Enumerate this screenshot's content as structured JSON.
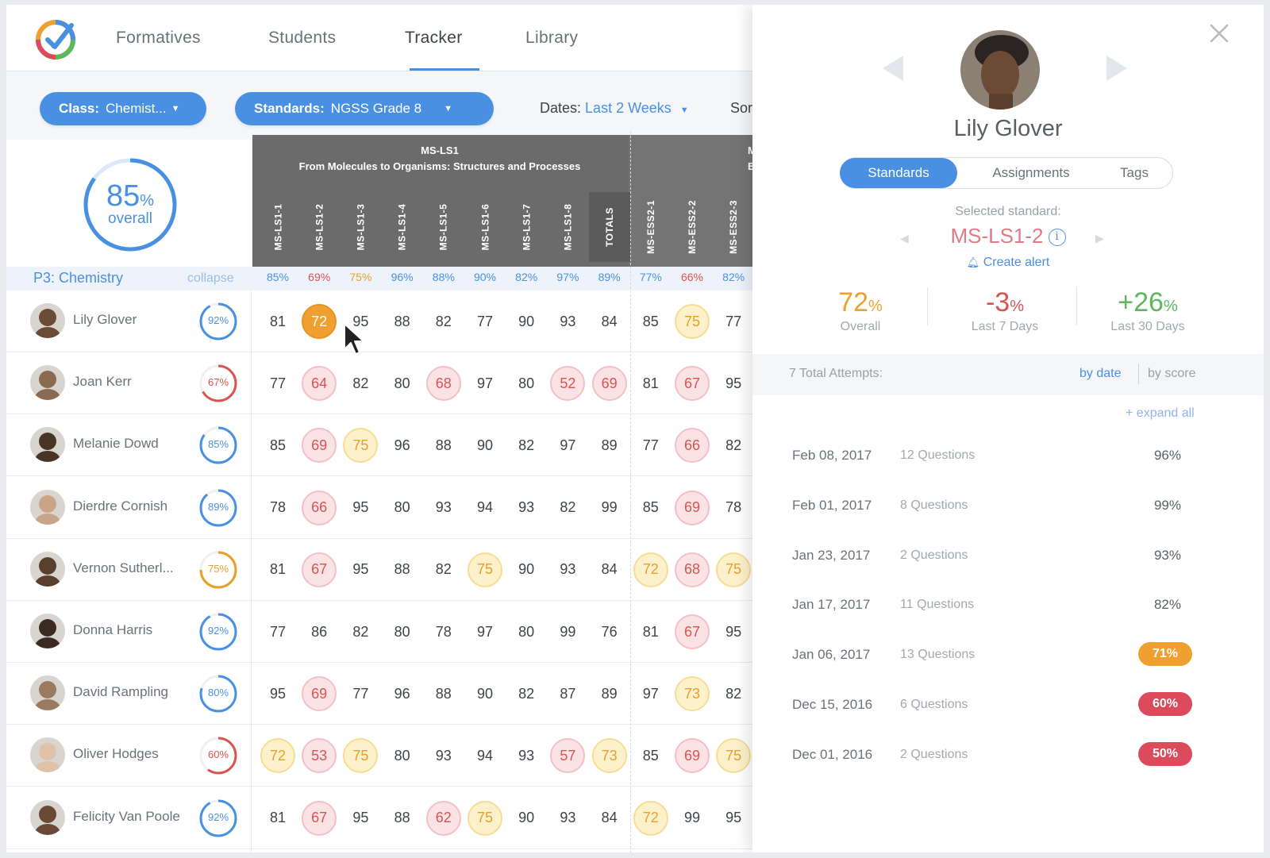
{
  "nav": {
    "tabs": [
      "Formatives",
      "Students",
      "Tracker",
      "Library"
    ],
    "active": "Tracker"
  },
  "filters": {
    "class_label": "Class:",
    "class_value": "Chemist...",
    "standards_label": "Standards:",
    "standards_value": "NGSS Grade 8",
    "dates_label": "Dates:",
    "dates_value": "Last 2 Weeks",
    "sort_label": "Sort:"
  },
  "overall": {
    "value": "85",
    "unit": "%",
    "label": "overall",
    "fraction": 0.85
  },
  "class_row": {
    "name": "P3:  Chemistry",
    "collapse": "collapse"
  },
  "standards": {
    "group1_code": "MS-LS1",
    "group1_title": "From Molecules to Organisms: Structures and Processes",
    "group2_code": "M",
    "group2_title": "Earth",
    "columns": [
      "MS-LS1-1",
      "MS-LS1-2",
      "MS-LS1-3",
      "MS-LS1-4",
      "MS-LS1-5",
      "MS-LS1-6",
      "MS-LS1-7",
      "MS-LS1-8",
      "TOTALS",
      "MS-ESS2-1",
      "MS-ESS2-2",
      "MS-ESS2-3"
    ],
    "averages": [
      "85%",
      "69%",
      "75%",
      "96%",
      "88%",
      "90%",
      "82%",
      "97%",
      "89%",
      "77%",
      "66%",
      "82%"
    ],
    "average_tones": [
      "blue",
      "red",
      "yellow",
      "blue",
      "blue",
      "blue",
      "blue",
      "blue",
      "blue",
      "blue",
      "red",
      "blue"
    ]
  },
  "students": [
    {
      "name": "Lily Glover",
      "overall": "92%",
      "fraction": 0.92,
      "tone": "blue",
      "scores": [
        81,
        72,
        95,
        88,
        82,
        77,
        90,
        93,
        84,
        85,
        75,
        77
      ]
    },
    {
      "name": "Joan Kerr",
      "overall": "67%",
      "fraction": 0.67,
      "tone": "red",
      "scores": [
        77,
        64,
        82,
        80,
        68,
        97,
        80,
        52,
        69,
        81,
        67,
        95
      ]
    },
    {
      "name": "Melanie Dowd",
      "overall": "85%",
      "fraction": 0.85,
      "tone": "blue",
      "scores": [
        85,
        69,
        75,
        96,
        88,
        90,
        82,
        97,
        89,
        77,
        66,
        82
      ]
    },
    {
      "name": "Dierdre Cornish",
      "overall": "89%",
      "fraction": 0.89,
      "tone": "blue",
      "scores": [
        78,
        66,
        95,
        80,
        93,
        94,
        93,
        82,
        99,
        85,
        69,
        78
      ]
    },
    {
      "name": "Vernon Sutherl...",
      "overall": "75%",
      "fraction": 0.75,
      "tone": "yellow",
      "scores": [
        81,
        67,
        95,
        88,
        82,
        75,
        90,
        93,
        84,
        72,
        68,
        75
      ]
    },
    {
      "name": "Donna Harris",
      "overall": "92%",
      "fraction": 0.92,
      "tone": "blue",
      "scores": [
        77,
        86,
        82,
        80,
        78,
        97,
        80,
        99,
        76,
        81,
        67,
        95
      ]
    },
    {
      "name": "David Rampling",
      "overall": "80%",
      "fraction": 0.8,
      "tone": "blue",
      "scores": [
        95,
        69,
        77,
        96,
        88,
        90,
        82,
        87,
        89,
        97,
        73,
        82
      ]
    },
    {
      "name": "Oliver Hodges",
      "overall": "60%",
      "fraction": 0.6,
      "tone": "red",
      "scores": [
        72,
        53,
        75,
        80,
        93,
        94,
        93,
        57,
        73,
        85,
        69,
        75
      ]
    },
    {
      "name": "Felicity Van Poole",
      "overall": "92%",
      "fraction": 0.92,
      "tone": "blue",
      "scores": [
        81,
        67,
        95,
        88,
        62,
        75,
        90,
        93,
        84,
        72,
        99,
        95
      ]
    }
  ],
  "highlight": {
    "student": "Lily Glover",
    "column": "MS-LS1-2"
  },
  "colors": {
    "accent": "#4a90e2",
    "red": "#d9534f",
    "yellow": "#e6a02a",
    "green": "#4caf50",
    "header": "#6b6b6b"
  },
  "panel": {
    "student_name": "Lily Glover",
    "tabs": [
      "Standards",
      "Assignments",
      "Tags"
    ],
    "active_tab": "Standards",
    "selected_label": "Selected standard:",
    "selected_standard": "MS-LS1-2",
    "create_alert": "Create alert",
    "stats": [
      {
        "value": "72",
        "unit": "%",
        "label": "Overall",
        "color": "#f0a030"
      },
      {
        "value": "-3",
        "unit": "%",
        "label": "Last 7 Days",
        "color": "#d9534f"
      },
      {
        "value": "+26",
        "unit": "%",
        "label": "Last 30 Days",
        "color": "#5cb85c"
      }
    ],
    "attempts_label": "7 Total Attempts:",
    "by_date": "by date",
    "by_score": "by score",
    "expand_all": "+ expand all",
    "attempts": [
      {
        "date": "Feb 08, 2017",
        "questions": "12 Questions",
        "score": "96%",
        "badge": ""
      },
      {
        "date": "Feb 01, 2017",
        "questions": "8 Questions",
        "score": "99%",
        "badge": ""
      },
      {
        "date": "Jan 23, 2017",
        "questions": "2 Questions",
        "score": "93%",
        "badge": ""
      },
      {
        "date": "Jan 17, 2017",
        "questions": "11 Questions",
        "score": "82%",
        "badge": ""
      },
      {
        "date": "Jan 06, 2017",
        "questions": "13 Questions",
        "score": "71%",
        "badge": "#f0a030"
      },
      {
        "date": "Dec 15, 2016",
        "questions": "6 Questions",
        "score": "60%",
        "badge": "#dc4b5c"
      },
      {
        "date": "Dec 01, 2016",
        "questions": "2 Questions",
        "score": "50%",
        "badge": "#dc4b5c"
      }
    ]
  }
}
